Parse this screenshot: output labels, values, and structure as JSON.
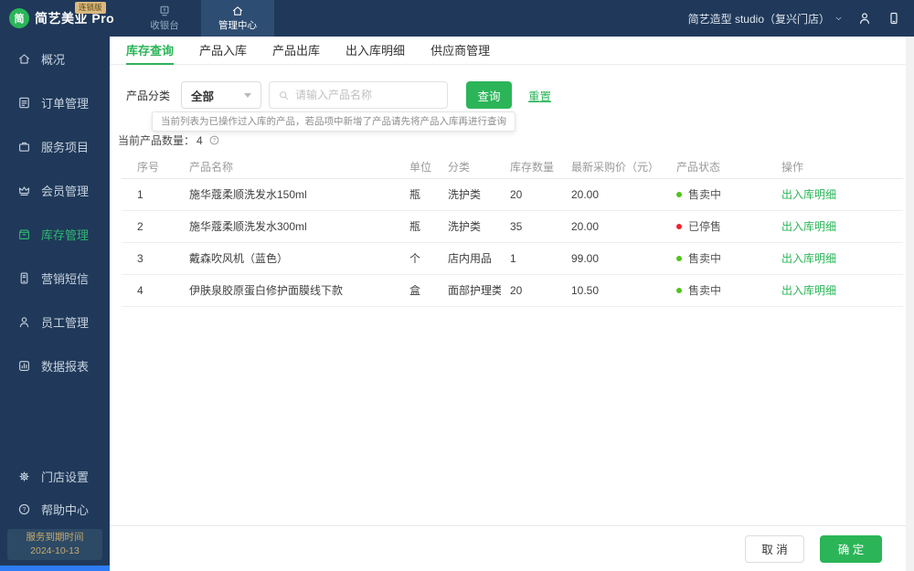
{
  "colors": {
    "accent_green": "#2bb558",
    "navy": "#20395a",
    "navy_active": "#2e4d72",
    "status_green": "#52c41a",
    "status_red": "#f5222d",
    "badge_bg": "#d9b97e",
    "expiry_text": "#c9aa6c"
  },
  "topbar": {
    "logo": {
      "badge": "连锁版",
      "icon_char": "简",
      "text": "简艺美业 Pro"
    },
    "nav_tabs": [
      {
        "id": "cashier",
        "label": "收银台",
        "icon": "cashier-icon",
        "active": false
      },
      {
        "id": "management",
        "label": "管理中心",
        "icon": "management-home-icon",
        "active": true
      }
    ],
    "store_selector": "简艺造型 studio（复兴门店）"
  },
  "sidebar": {
    "items": [
      {
        "id": "overview",
        "label": "概况",
        "icon": "home-icon",
        "active": false
      },
      {
        "id": "orders",
        "label": "订单管理",
        "icon": "orders-icon",
        "active": false
      },
      {
        "id": "services",
        "label": "服务项目",
        "icon": "briefcase-icon",
        "active": false
      },
      {
        "id": "members",
        "label": "会员管理",
        "icon": "crown-icon",
        "active": false
      },
      {
        "id": "inventory",
        "label": "库存管理",
        "icon": "box-icon",
        "active": true
      },
      {
        "id": "sms",
        "label": "营销短信",
        "icon": "sms-icon",
        "active": false
      },
      {
        "id": "staff",
        "label": "员工管理",
        "icon": "person-icon",
        "active": false
      },
      {
        "id": "reports",
        "label": "数据报表",
        "icon": "chart-icon",
        "active": false
      }
    ],
    "bottom_items": [
      {
        "id": "store-settings",
        "label": "门店设置",
        "icon": "gear-icon",
        "active": false
      },
      {
        "id": "help",
        "label": "帮助中心",
        "icon": "help-icon",
        "active": false
      }
    ],
    "expiry": {
      "label": "服务到期时间",
      "date": "2024-10-13"
    }
  },
  "main": {
    "tabs": [
      {
        "id": "stock-query",
        "label": "库存查询",
        "active": true
      },
      {
        "id": "product-in",
        "label": "产品入库",
        "active": false
      },
      {
        "id": "product-out",
        "label": "产品出库",
        "active": false
      },
      {
        "id": "inout-detail",
        "label": "出入库明细",
        "active": false
      },
      {
        "id": "supplier",
        "label": "供应商管理",
        "active": false
      }
    ],
    "filter": {
      "category_label": "产品分类",
      "category_value": "全部",
      "search_placeholder": "请输入产品名称",
      "search_button": "查询",
      "reset_link": "重置"
    },
    "tooltip": "当前列表为已操作过入库的产品，若品项中新增了产品请先将产品入库再进行查询",
    "count": {
      "label": "当前产品数量：",
      "value": "4"
    },
    "table": {
      "headers": [
        "序号",
        "产品名称",
        "单位",
        "分类",
        "库存数量",
        "最新采购价（元）",
        "产品状态",
        "操作"
      ],
      "rows": [
        {
          "index": "1",
          "name": "施华蔻柔顺洗发水150ml",
          "unit": "瓶",
          "category": "洗护类",
          "stock": "20",
          "price": "20.00",
          "status": "售卖中",
          "status_color": "green",
          "action": "出入库明细"
        },
        {
          "index": "2",
          "name": "施华蔻柔顺洗发水300ml",
          "unit": "瓶",
          "category": "洗护类",
          "stock": "35",
          "price": "20.00",
          "status": "已停售",
          "status_color": "red",
          "action": "出入库明细"
        },
        {
          "index": "3",
          "name": "戴森吹风机（蓝色）",
          "unit": "个",
          "category": "店内用品",
          "stock": "1",
          "price": "99.00",
          "status": "售卖中",
          "status_color": "green",
          "action": "出入库明细"
        },
        {
          "index": "4",
          "name": "伊肤泉胶原蛋白修护面膜线下款",
          "unit": "盒",
          "category": "面部护理类",
          "stock": "20",
          "price": "10.50",
          "status": "售卖中",
          "status_color": "green",
          "action": "出入库明细"
        }
      ]
    },
    "footer": {
      "cancel_label": "取 消",
      "confirm_label": "确 定"
    }
  }
}
